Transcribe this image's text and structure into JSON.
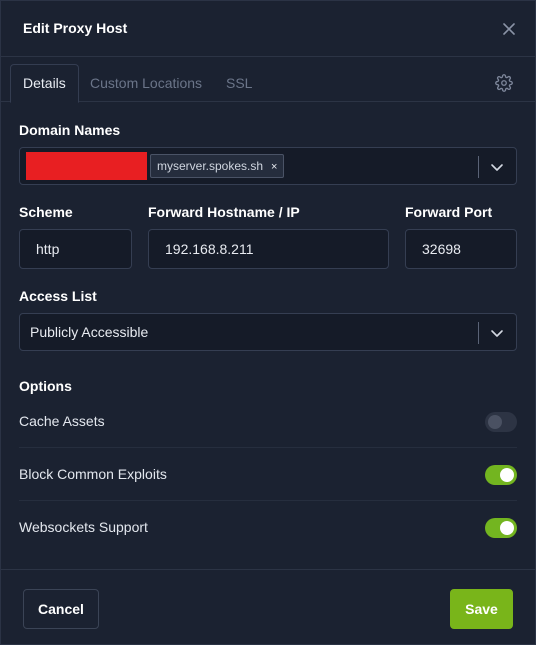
{
  "modal": {
    "title": "Edit Proxy Host"
  },
  "tabs": [
    {
      "label": "Details",
      "active": true
    },
    {
      "label": "Custom Locations",
      "active": false
    },
    {
      "label": "SSL",
      "active": false
    }
  ],
  "form": {
    "domain_names_label": "Domain Names",
    "domain_tags": [
      "myserver.spokes.sh"
    ],
    "tag_remove_glyph": "×",
    "scheme_label": "Scheme",
    "scheme_value": "http",
    "forward_host_label": "Forward Hostname / IP",
    "forward_host_value": "192.168.8.211",
    "forward_port_label": "Forward Port",
    "forward_port_value": "32698",
    "access_list_label": "Access List",
    "access_list_value": "Publicly Accessible"
  },
  "options": {
    "heading": "Options",
    "items": [
      {
        "label": "Cache Assets",
        "enabled": false
      },
      {
        "label": "Block Common Exploits",
        "enabled": true
      },
      {
        "label": "Websockets Support",
        "enabled": true
      }
    ]
  },
  "footer": {
    "cancel_label": "Cancel",
    "save_label": "Save"
  },
  "colors": {
    "accent_green": "#79b51a",
    "background": "#1b2231",
    "redaction": "#e81f22"
  },
  "icons": {
    "close": "close-icon",
    "settings": "gear-icon",
    "dropdown": "chevron-down-icon"
  }
}
